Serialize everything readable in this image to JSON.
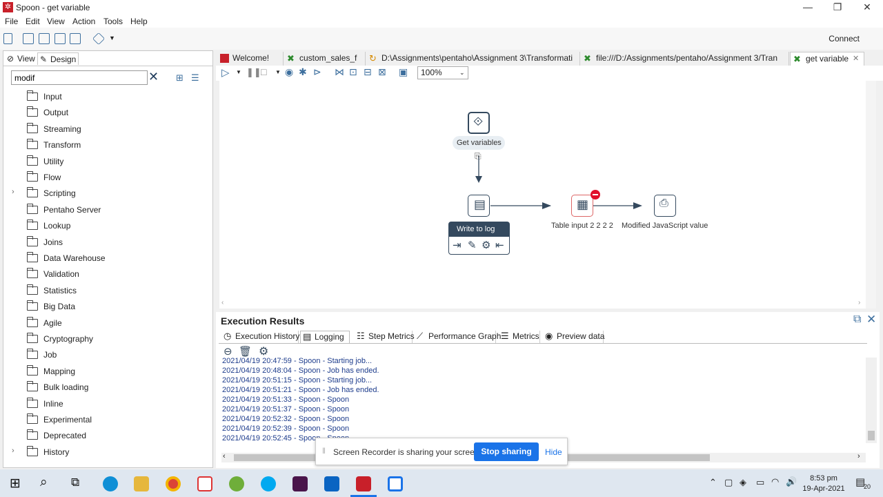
{
  "window": {
    "title": "Spoon - get variable",
    "minimize": "—",
    "restore": "❐",
    "close": "✕"
  },
  "menu": [
    "File",
    "Edit",
    "View",
    "Action",
    "Tools",
    "Help"
  ],
  "toolbar": {
    "connect_label": "Connect"
  },
  "left_panel": {
    "tab_view": "View",
    "tab_design": "Design",
    "search_value": "modif",
    "tree": [
      {
        "label": "Input",
        "expandable": false
      },
      {
        "label": "Output",
        "expandable": false
      },
      {
        "label": "Streaming",
        "expandable": false
      },
      {
        "label": "Transform",
        "expandable": false
      },
      {
        "label": "Utility",
        "expandable": false
      },
      {
        "label": "Flow",
        "expandable": false
      },
      {
        "label": "Scripting",
        "expandable": true
      },
      {
        "label": "Pentaho Server",
        "expandable": false
      },
      {
        "label": "Lookup",
        "expandable": false
      },
      {
        "label": "Joins",
        "expandable": false
      },
      {
        "label": "Data Warehouse",
        "expandable": false
      },
      {
        "label": "Validation",
        "expandable": false
      },
      {
        "label": "Statistics",
        "expandable": false
      },
      {
        "label": "Big Data",
        "expandable": false
      },
      {
        "label": "Agile",
        "expandable": false
      },
      {
        "label": "Cryptography",
        "expandable": false
      },
      {
        "label": "Job",
        "expandable": false
      },
      {
        "label": "Mapping",
        "expandable": false
      },
      {
        "label": "Bulk loading",
        "expandable": false
      },
      {
        "label": "Inline",
        "expandable": false
      },
      {
        "label": "Experimental",
        "expandable": false
      },
      {
        "label": "Deprecated",
        "expandable": false
      },
      {
        "label": "History",
        "expandable": true
      }
    ]
  },
  "tabs": [
    {
      "label": "Welcome!",
      "icon": "spoon-icon"
    },
    {
      "label": "custom_sales_f",
      "icon": "transformation-icon"
    },
    {
      "label": "D:\\Assignments\\pentaho\\Assignment 3\\Transformati",
      "icon": "job-icon"
    },
    {
      "label": "file:///D:/Assignments/pentaho/Assignment 3/Tran",
      "icon": "transformation-icon"
    },
    {
      "label": "get variable",
      "icon": "transformation-icon",
      "active": true
    }
  ],
  "canvas": {
    "zoom": "100%",
    "steps": {
      "get_variables": "Get variables",
      "write_to_log": "Write to log",
      "table_input": "Table input 2 2 2 2",
      "modified_js": "Modified JavaScript value"
    }
  },
  "execution": {
    "title": "Execution Results",
    "tabs": [
      "Execution History",
      "Logging",
      "Step Metrics",
      "Performance Graph",
      "Metrics",
      "Preview data"
    ],
    "log": [
      "2021/04/19 20:47:59 - Spoon - Starting job...",
      "2021/04/19 20:48:04 - Spoon - Job has ended.",
      "2021/04/19 20:51:15 - Spoon - Starting job...",
      "2021/04/19 20:51:21 - Spoon - Job has ended.",
      "2021/04/19 20:51:33 - Spoon - Spoon",
      "2021/04/19 20:51:37 - Spoon - Spoon",
      "2021/04/19 20:52:32 - Spoon - Spoon",
      "2021/04/19 20:52:39 - Spoon - Spoon",
      "2021/04/19 20:52:45 - Spoon - Spoon"
    ]
  },
  "share": {
    "message": "Screen Recorder is sharing your screen.",
    "stop_label": "Stop sharing",
    "hide_label": "Hide"
  },
  "taskbar": {
    "time": "8:53 pm",
    "date": "19-Apr-2021",
    "notifications": "20"
  },
  "colors": {
    "accent": "#1a73e8",
    "spoon_red": "#c8202a",
    "step_border": "#34495e",
    "log_text": "#1d3c8c",
    "error_red": "#e0102a"
  }
}
